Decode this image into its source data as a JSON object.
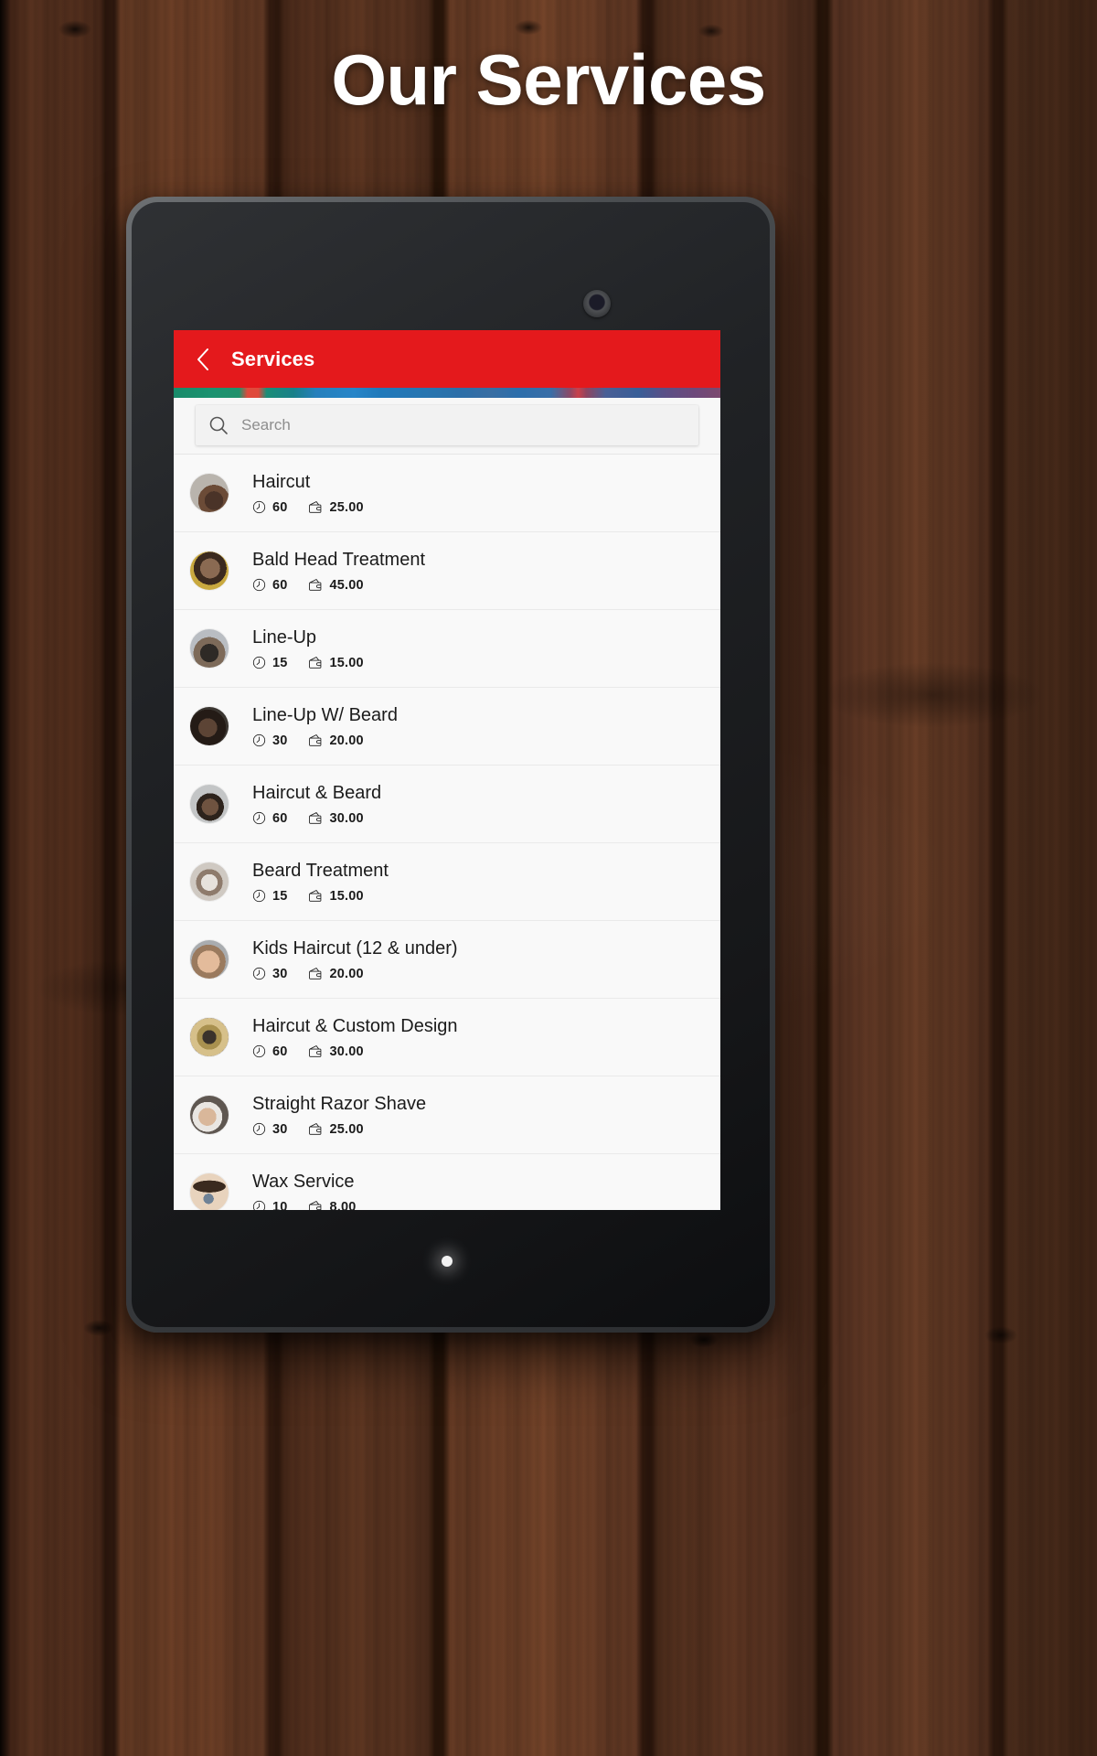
{
  "page": {
    "title": "Our Services",
    "background": "#482a1c",
    "title_color": "#ffffff"
  },
  "device": {
    "camera_icon": "camera-lens-icon",
    "led_icon": "status-led-icon"
  },
  "app": {
    "accent_color": "#e4191c",
    "appbar": {
      "back_icon": "chevron-left-icon",
      "title": "Services"
    },
    "search": {
      "icon": "search-icon",
      "value": "",
      "placeholder": "Search"
    },
    "meta_icons": {
      "duration": "clock-icon",
      "price": "wallet-icon"
    },
    "services": [
      {
        "name": "Haircut",
        "duration": "60",
        "price": "25.00",
        "avatar_icon": "service-photo-haircut"
      },
      {
        "name": "Bald Head Treatment",
        "duration": "60",
        "price": "45.00",
        "avatar_icon": "service-photo-bald-head-treatment"
      },
      {
        "name": "Line-Up",
        "duration": "15",
        "price": "15.00",
        "avatar_icon": "service-photo-line-up"
      },
      {
        "name": "Line-Up W/ Beard",
        "duration": "30",
        "price": "20.00",
        "avatar_icon": "service-photo-line-up-w-beard"
      },
      {
        "name": "Haircut & Beard",
        "duration": "60",
        "price": "30.00",
        "avatar_icon": "service-photo-haircut-beard"
      },
      {
        "name": "Beard Treatment",
        "duration": "15",
        "price": "15.00",
        "avatar_icon": "service-photo-beard-treatment"
      },
      {
        "name": "Kids Haircut (12 & under)",
        "duration": "30",
        "price": "20.00",
        "avatar_icon": "service-photo-kids-haircut"
      },
      {
        "name": "Haircut & Custom Design",
        "duration": "60",
        "price": "30.00",
        "avatar_icon": "service-photo-custom-design"
      },
      {
        "name": "Straight Razor Shave",
        "duration": "30",
        "price": "25.00",
        "avatar_icon": "service-photo-razor-shave"
      },
      {
        "name": "Wax Service",
        "duration": "10",
        "price": "8.00",
        "avatar_icon": "service-photo-wax-service"
      }
    ]
  }
}
